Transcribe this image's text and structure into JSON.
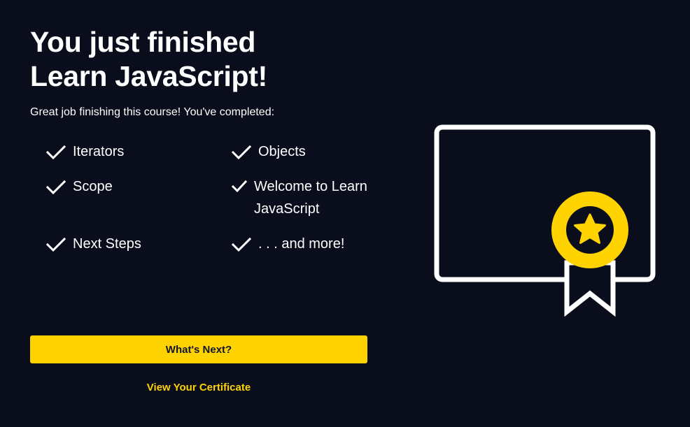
{
  "header": {
    "title_line1": "You just finished",
    "title_line2": "Learn JavaScript!",
    "subtitle": "Great job finishing this course! You've completed:"
  },
  "completed_items": {
    "col1": [
      "Iterators",
      "Scope",
      "Next Steps"
    ],
    "col2": [
      "Objects",
      "Welcome to Learn",
      "JavaScript",
      ". . . and more!"
    ]
  },
  "actions": {
    "next_label": "What's Next?",
    "certificate_label": "View Your Certificate"
  },
  "icons": {
    "check": "check-icon",
    "certificate": "certificate-icon",
    "star": "star-icon"
  },
  "colors": {
    "background": "#0a0d1c",
    "accent": "#ffd300",
    "text": "#ffffff",
    "button_text": "#10162f"
  }
}
